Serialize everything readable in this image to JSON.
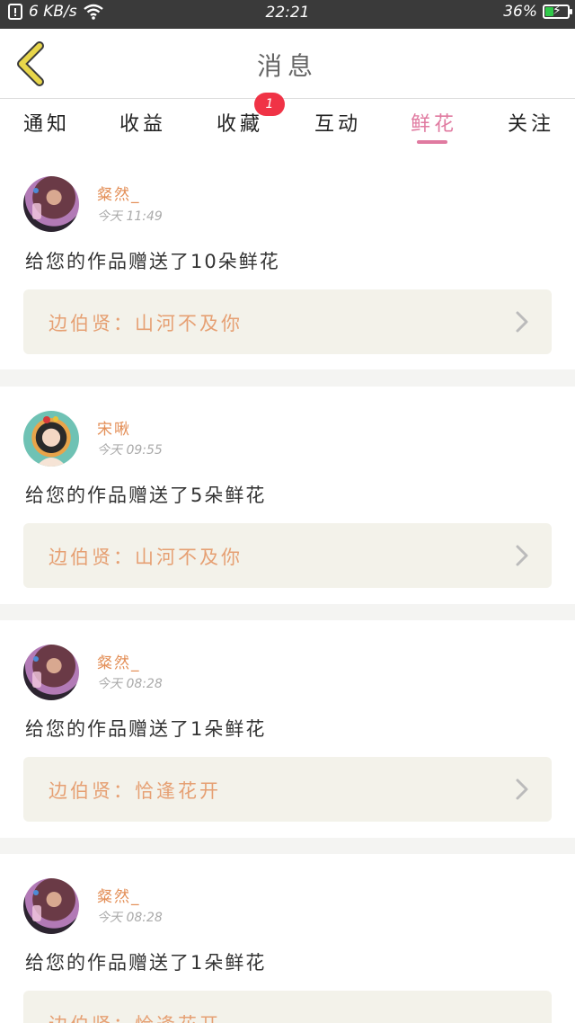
{
  "status_bar": {
    "speed": "6 KB/s",
    "time": "22:21",
    "battery_percent": "36%",
    "battery_level": 0.36
  },
  "nav": {
    "title": "消息"
  },
  "tabs": [
    {
      "label": "通知"
    },
    {
      "label": "收益"
    },
    {
      "label": "收藏",
      "badge": "1"
    },
    {
      "label": "互动"
    },
    {
      "label": "鲜花",
      "active": true
    },
    {
      "label": "关注"
    }
  ],
  "messages": [
    {
      "username": "粲然_",
      "time": "今天 11:49",
      "text": "给您的作品赠送了10朵鲜花",
      "work": "边伯贤：山河不及你"
    },
    {
      "username": "宋啾",
      "time": "今天 09:55",
      "text": "给您的作品赠送了5朵鲜花",
      "work": "边伯贤：山河不及你"
    },
    {
      "username": "粲然_",
      "time": "今天 08:28",
      "text": "给您的作品赠送了1朵鲜花",
      "work": "边伯贤：恰逢花开"
    },
    {
      "username": "粲然_",
      "time": "今天 08:28",
      "text": "给您的作品赠送了1朵鲜花",
      "work": "边伯贤：恰逢花开"
    }
  ],
  "colors": {
    "accent": "#e07aa0",
    "username": "#e38e56",
    "work_text": "#e6a073",
    "badge": "#f03346",
    "back_arrow": "#e8d64a"
  }
}
